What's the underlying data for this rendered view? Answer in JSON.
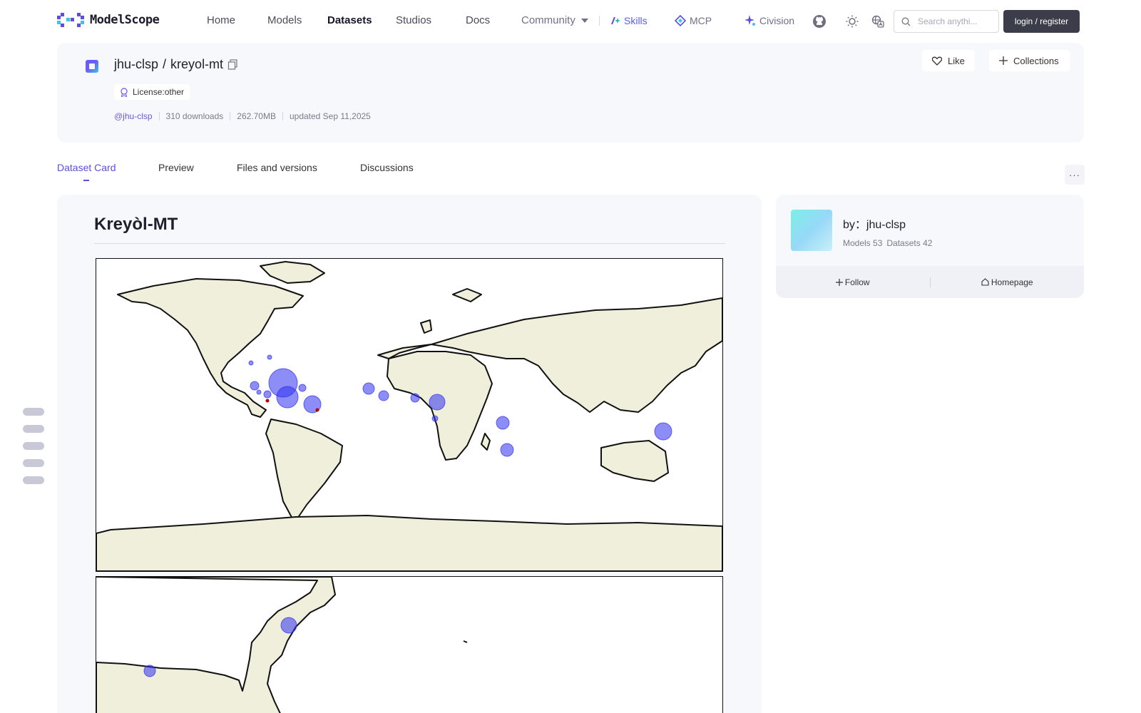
{
  "brand": {
    "name": "ModelScope"
  },
  "nav": {
    "home": "Home",
    "models": "Models",
    "datasets": "Datasets",
    "studios": "Studios",
    "docs": "Docs",
    "community": "Community",
    "skills": "Skills",
    "mcp": "MCP",
    "civision": "Civision"
  },
  "search": {
    "placeholder": "Search anythi..."
  },
  "auth": {
    "login": "login / register"
  },
  "repo": {
    "owner": "jhu-clsp",
    "name": "kreyol-mt",
    "separator": "/",
    "license": "License:other",
    "user_tag": "@jhu-clsp",
    "downloads": "310 downloads",
    "size": "262.70MB",
    "updated": "updated Sep 11,2025",
    "like": "Like",
    "collections": "Collections"
  },
  "tabs": [
    "Dataset Card",
    "Preview",
    "Files and versions",
    "Discussions"
  ],
  "more": "···",
  "card": {
    "title": "Kreyòl-MT"
  },
  "author": {
    "by": "by：jhu-clsp",
    "models": "Models 53",
    "datasets": "Datasets 42",
    "follow": "Follow",
    "homepage": "Homepage"
  },
  "colors": {
    "accent": "#5b4fe0",
    "land": "#efefdb",
    "marker": "#2f2ff0",
    "marker_red": "#c00000",
    "login_bg": "#3b3e4a"
  },
  "icons": [
    "logo-icon",
    "skills-icon",
    "mcp-icon",
    "civision-icon",
    "github-icon",
    "sun-icon",
    "translate-icon",
    "search-icon",
    "copy-icon",
    "license-icon",
    "heart-icon",
    "plus-icon",
    "home-icon"
  ]
}
